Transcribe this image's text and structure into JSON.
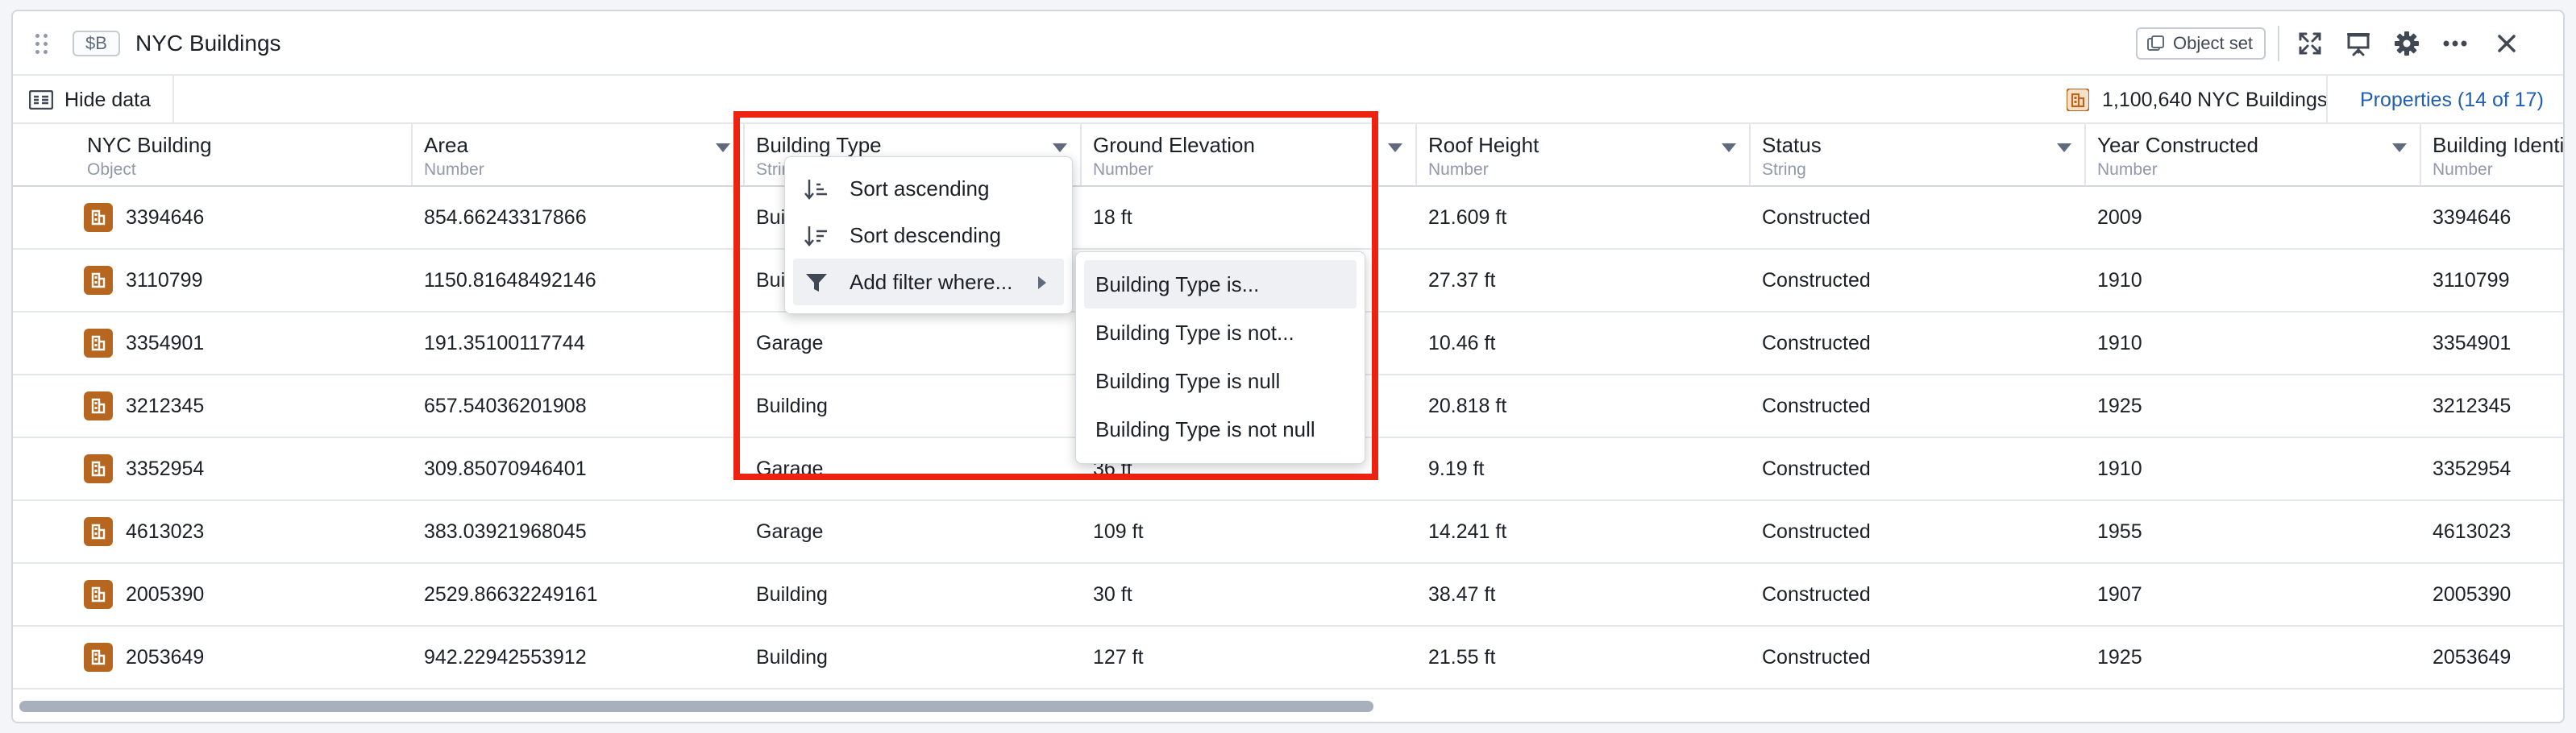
{
  "header": {
    "variable_chip": "$B",
    "title": "NYC Buildings",
    "object_set_label": "Object set",
    "icons": [
      "drag-handle-icon",
      "object-set-icon",
      "fullscreen-icon",
      "presentation-icon",
      "gear-icon",
      "more-icon",
      "close-icon"
    ]
  },
  "toolbar": {
    "hide_data_label": "Hide data",
    "object_count": "1,100,640 NYC Buildings",
    "properties_link": "Properties (14 of 17)"
  },
  "table": {
    "columns": [
      {
        "name": "NYC Building",
        "type": "Object"
      },
      {
        "name": "Area",
        "type": "Number"
      },
      {
        "name": "Building Type",
        "type": "String"
      },
      {
        "name": "Ground Elevation",
        "type": "Number"
      },
      {
        "name": "Roof Height",
        "type": "Number"
      },
      {
        "name": "Status",
        "type": "String"
      },
      {
        "name": "Year Constructed",
        "type": "Number"
      },
      {
        "name": "Building Identifier",
        "type": "Number"
      }
    ],
    "rows": [
      [
        "3394646",
        "854.66243317866",
        "Building",
        "18 ft",
        "21.609 ft",
        "Constructed",
        "2009",
        "3394646"
      ],
      [
        "3110799",
        "1150.81648492146",
        "Building",
        "",
        "27.37 ft",
        "Constructed",
        "1910",
        "3110799"
      ],
      [
        "3354901",
        "191.35100117744",
        "Garage",
        "",
        "10.46 ft",
        "Constructed",
        "1910",
        "3354901"
      ],
      [
        "3212345",
        "657.54036201908",
        "Building",
        "",
        "20.818 ft",
        "Constructed",
        "1925",
        "3212345"
      ],
      [
        "3352954",
        "309.85070946401",
        "Garage",
        "36 ft",
        "9.19 ft",
        "Constructed",
        "1910",
        "3352954"
      ],
      [
        "4613023",
        "383.03921968045",
        "Garage",
        "109 ft",
        "14.241 ft",
        "Constructed",
        "1955",
        "4613023"
      ],
      [
        "2005390",
        "2529.86632249161",
        "Building",
        "30 ft",
        "38.47 ft",
        "Constructed",
        "1907",
        "2005390"
      ],
      [
        "2053649",
        "942.22942553912",
        "Building",
        "127 ft",
        "21.55 ft",
        "Constructed",
        "1925",
        "2053649"
      ]
    ]
  },
  "column_menu": {
    "items": [
      {
        "label": "Sort ascending",
        "icon": "sort-ascending-icon"
      },
      {
        "label": "Sort descending",
        "icon": "sort-descending-icon"
      },
      {
        "label": "Add filter where...",
        "icon": "filter-icon"
      }
    ]
  },
  "filter_submenu": {
    "items": [
      "Building Type is...",
      "Building Type is not...",
      "Building Type is null",
      "Building Type is not null"
    ]
  },
  "colors": {
    "highlight": "#ee2210",
    "link": "#215db0",
    "object_icon": "#b7661f"
  }
}
